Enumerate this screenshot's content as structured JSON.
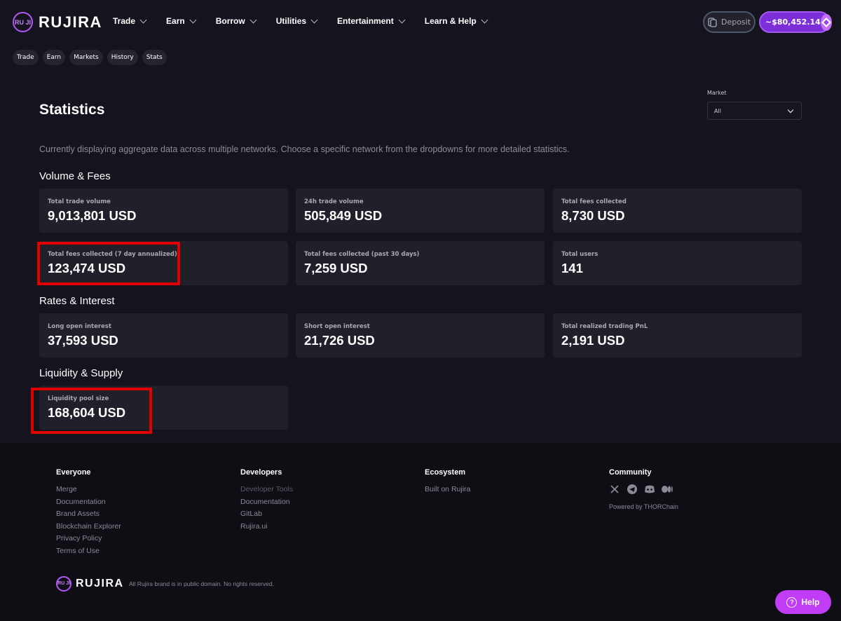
{
  "brand": {
    "name": "RUJIRA",
    "mark": "RU JI"
  },
  "nav": [
    {
      "label": "Trade"
    },
    {
      "label": "Earn"
    },
    {
      "label": "Borrow"
    },
    {
      "label": "Utilities"
    },
    {
      "label": "Entertainment"
    },
    {
      "label": "Learn & Help"
    }
  ],
  "header": {
    "deposit_label": "Deposit",
    "balance": "~$80,452.14"
  },
  "subnav": [
    "Trade",
    "Earn",
    "Markets",
    "History",
    "Stats"
  ],
  "page": {
    "title": "Statistics",
    "market_label": "Market",
    "market_value": "All",
    "description": "Currently displaying aggregate data across multiple networks. Choose a specific network from the dropdowns for more detailed statistics."
  },
  "sections": {
    "volume_fees": {
      "title": "Volume & Fees",
      "cards": [
        {
          "label": "Total trade volume",
          "value": "9,013,801 USD"
        },
        {
          "label": "24h trade volume",
          "value": "505,849 USD"
        },
        {
          "label": "Total fees collected",
          "value": "8,730 USD"
        },
        {
          "label": "Total fees collected (7 day annualized)",
          "value": "123,474 USD"
        },
        {
          "label": "Total fees collected (past 30 days)",
          "value": "7,259 USD"
        },
        {
          "label": "Total users",
          "value": "141"
        }
      ]
    },
    "rates_interest": {
      "title": "Rates & Interest",
      "cards": [
        {
          "label": "Long open interest",
          "value": "37,593 USD"
        },
        {
          "label": "Short open interest",
          "value": "21,726 USD"
        },
        {
          "label": "Total realized trading PnL",
          "value": "2,191 USD"
        }
      ]
    },
    "liquidity_supply": {
      "title": "Liquidity & Supply",
      "cards": [
        {
          "label": "Liquidity pool size",
          "value": "168,604 USD"
        }
      ]
    }
  },
  "footer": {
    "everyone": {
      "title": "Everyone",
      "links": [
        "Merge",
        "Documentation",
        "Brand Assets",
        "Blockchain Explorer",
        "Privacy Policy",
        "Terms of Use"
      ]
    },
    "developers": {
      "title": "Developers",
      "links": [
        "Developer Tools",
        "Documentation",
        "GitLab",
        "Rujira.ui"
      ]
    },
    "ecosystem": {
      "title": "Ecosystem",
      "links": [
        "Built on Rujira"
      ]
    },
    "community": {
      "title": "Community",
      "socials": [
        "x-icon",
        "telegram-icon",
        "discord-icon",
        "medium-icon"
      ],
      "powered": "Powered by THORChain"
    },
    "copyright": "All Rujira brand is in public domain. No rights reserved."
  },
  "help_label": "Help",
  "colors": {
    "accent": "#c13cf5",
    "highlight": "#e00000",
    "card": "#20202a",
    "background": "#15141e"
  }
}
